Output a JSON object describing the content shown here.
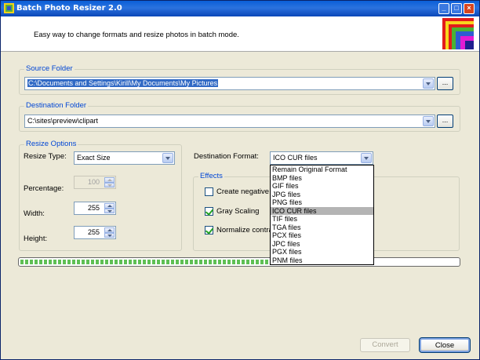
{
  "window": {
    "title": "Batch Photo Resizer 2.0",
    "tagline": "Easy way to change formats and resize photos in batch mode."
  },
  "source": {
    "group_label": "Source Folder",
    "path": "C:\\Documents and Settings\\Kirill\\My Documents\\My Pictures",
    "browse_label": "..."
  },
  "destination": {
    "group_label": "Destination Folder",
    "path": "C:\\sites\\preview\\clipart",
    "browse_label": "..."
  },
  "resize": {
    "group_label": "Resize Options",
    "type_label": "Resize Type:",
    "type_value": "Exact Size",
    "percentage_label": "Percentage:",
    "percentage_value": "100",
    "width_label": "Width:",
    "width_value": "255",
    "height_label": "Height:",
    "height_value": "255"
  },
  "format": {
    "label": "Destination Format:",
    "selected": "ICO CUR files",
    "options": [
      "Remain Original Format",
      "BMP files",
      "GIF files",
      "JPG files",
      "PNG files",
      "ICO CUR files",
      "TIF files",
      "TGA files",
      "PCX files",
      "JPC files",
      "PGX files",
      "PNM files"
    ],
    "highlighted_index": 5
  },
  "effects": {
    "group_label": "Effects",
    "create_negative": {
      "label": "Create negative",
      "checked": false
    },
    "gray_scaling": {
      "label": "Gray Scaling",
      "checked": true
    },
    "normalize": {
      "label": "Normalize contra",
      "checked": true
    }
  },
  "progress": {
    "value": 0.57
  },
  "buttons": {
    "convert": "Convert",
    "close": "Close"
  },
  "title_buttons": {
    "minimize": "_",
    "maximize": "□",
    "close": "×"
  },
  "colors": {
    "accent": "#0046d5",
    "titlebar": "#0a5fd8",
    "selection": "#316ac5"
  }
}
